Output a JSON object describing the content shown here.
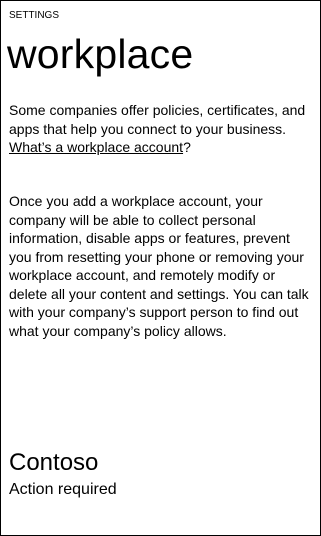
{
  "header": {
    "section_label": "SETTINGS",
    "title": "workplace"
  },
  "intro": {
    "text": "Some companies offer policies, certificates, and apps that help you connect to your business. ",
    "link_label": "What’s a workplace account",
    "after_link": "?"
  },
  "warning": {
    "text": "Once you add a workplace account, your company will be able to collect personal information, disable apps or features, prevent you from resetting your phone or removing your workplace account, and remotely modify or delete all your content and settings. You can talk with your company’s support person to find out what your company’s policy allows."
  },
  "accounts": [
    {
      "name": "Contoso",
      "status": "Action required"
    }
  ]
}
